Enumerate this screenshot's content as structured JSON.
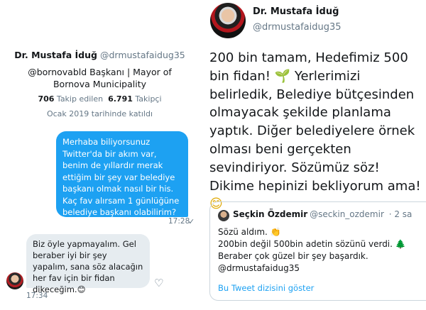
{
  "left": {
    "profile": {
      "name": "Dr. Mustafa İduğ",
      "handle": "@drmustafaidug35",
      "bio": "@bornovabld Başkanı | Mayor of Bornova Municipality",
      "following_count": "706",
      "following_label": "Takip edilen",
      "followers_count": "6.791",
      "followers_label": "Takipçi",
      "joined": "Ocak 2019 tarihinde katıldı"
    },
    "outgoing_message": {
      "text": "Merhaba biliyorsunuz Twitter'da bir akım var, benim de yıllardır merak ettiğim bir şey var belediye başkanı olmak nasıl bir his. Kaç fav alırsam 1 günlüğüne belediye başkanı olabilirim?",
      "time": "17:28"
    },
    "incoming_message": {
      "text": "Biz öyle yapmayalım. Gel beraber iyi bir şey yapalım, sana söz alacağın her fav için bir fidan dikeceğim.😊",
      "time": "17:34"
    }
  },
  "right": {
    "author": {
      "name": "Dr. Mustafa İduğ",
      "handle": "@drmustafaidug35"
    },
    "tweet": {
      "part1": "200 bin tamam, Hedefimiz 500 bin fidan! ",
      "seedling": "🌱",
      "part2": " Yerlerimizi belirledik, Belediye bütçesinden olmayacak şekilde planlama yaptık. Diğer belediyelere örnek olması beni gerçekten sevindiriyor. Sözümüz söz! Dikime hepinizi bekliyorum ama!",
      "smile": "😊"
    },
    "quoted": {
      "name": "Seçkin Özdemir",
      "handle": "@seckin_ozdemir",
      "time": "· 2 sa",
      "line1": "Sözü aldım. ",
      "wave": "👏",
      "line2": "200bin değil 500bin adetin sözünü verdi. ",
      "tree": "🌲",
      "line3": "Beraber çok güzel bir şey başardık.",
      "line4": "@drmustafaidug35",
      "thread_link": "Bu Tweet dizisini göster"
    }
  },
  "icons": {
    "check": "check-icon",
    "heart": "heart-add-icon"
  }
}
